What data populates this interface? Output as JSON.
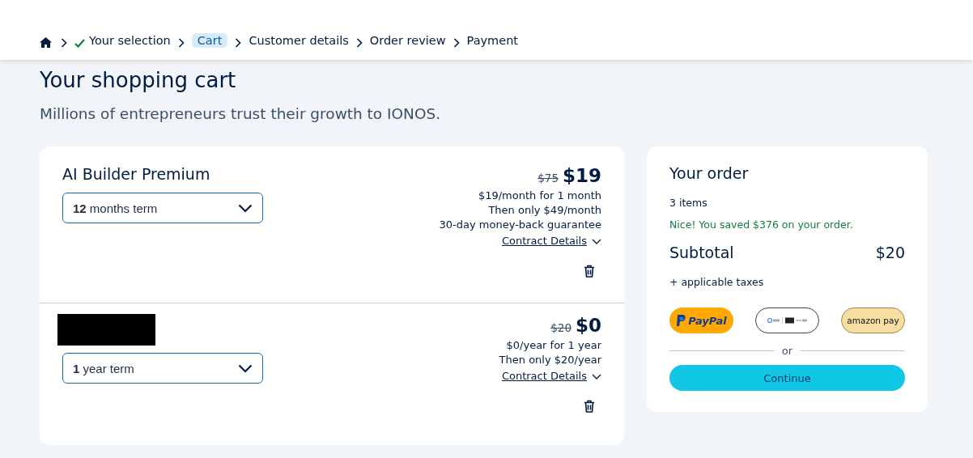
{
  "breadcrumb": [
    {
      "label": "Your selection",
      "done": true,
      "selected": false
    },
    {
      "label": "Cart",
      "done": false,
      "selected": true
    },
    {
      "label": "Customer details",
      "done": false,
      "selected": false
    },
    {
      "label": "Order review",
      "done": false,
      "selected": false
    },
    {
      "label": "Payment",
      "done": false,
      "selected": false
    }
  ],
  "title": "Your shopping cart",
  "subtitle": "Millions of entrepreneurs trust their growth to IONOS.",
  "items": [
    {
      "kind": "named",
      "name": "AI Builder Premium",
      "term": "**12** months term",
      "old_price": "$75",
      "price": "$19",
      "lines": [
        "$19/month for 1 month",
        "Then only $49/month",
        "30-day money-back guarantee"
      ],
      "details_link": "Contract Details"
    },
    {
      "kind": "redacted",
      "term": "**1** year term",
      "old_price": "$20",
      "price": "$0",
      "lines": [
        "$0/year for 1 year",
        "Then only $20/year"
      ],
      "details_link": "Contract Details"
    }
  ],
  "order": {
    "title": "Your order",
    "count": "3 items",
    "savings": "Nice! You saved $376 on your order.",
    "subtotal_label": "Subtotal",
    "subtotal": "$20",
    "taxes": "+ applicable taxes",
    "pay_buttons": [
      {
        "kind": "paypal",
        "label": "PayPal"
      },
      {
        "kind": "gpay"
      },
      {
        "kind": "amazon",
        "label": "amazon pay"
      }
    ],
    "or": "or",
    "continue": "Continue"
  }
}
